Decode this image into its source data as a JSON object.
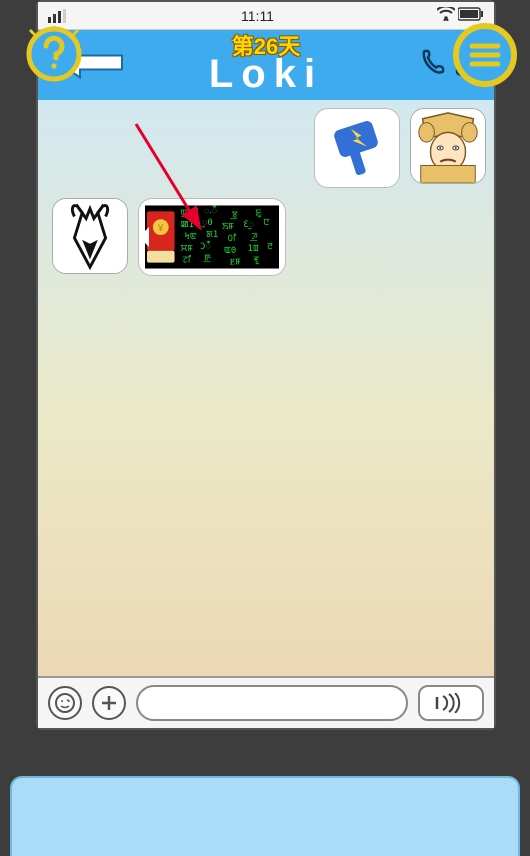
{
  "status": {
    "time": "11:11"
  },
  "title": {
    "day_label": "第26天",
    "name": "Loki"
  },
  "chat": {
    "thor": {
      "avatar_name": "thor-avatar",
      "bubble_name": "hammer-bubble"
    },
    "loki": {
      "avatar_name": "loki-avatar",
      "bubble_name": "virus-bubble"
    }
  },
  "input": {
    "placeholder": ""
  },
  "icons": {
    "hint": "hint-icon",
    "menu": "menu-icon",
    "phone": "phone-icon",
    "profile": "profile-icon",
    "emoji": "emoji-icon",
    "plus": "plus-icon",
    "voice": "voice-icon",
    "battery": "battery-icon",
    "wifi": "wifi-icon",
    "signal_left": "signal-left-icon"
  }
}
